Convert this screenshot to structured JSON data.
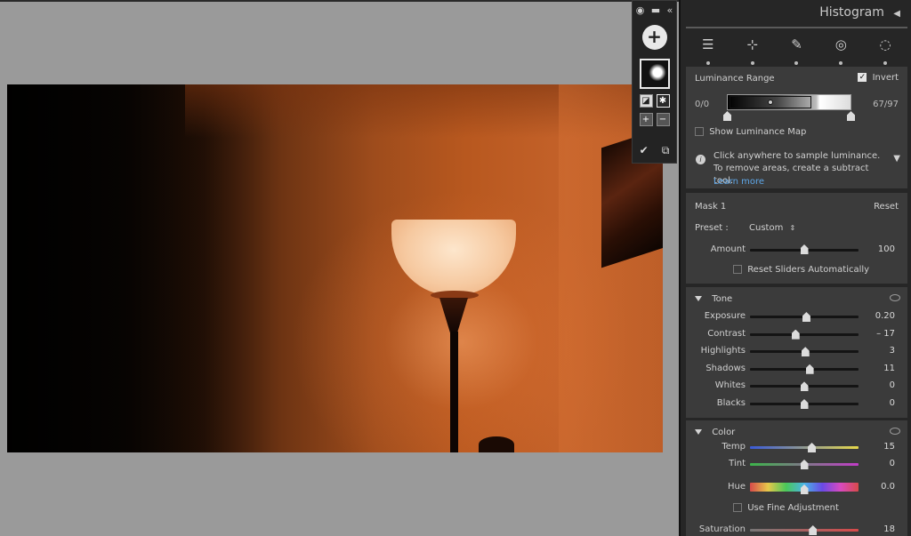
{
  "histogram": {
    "title": "Histogram",
    "collapse_icon": "triangle-left-icon"
  },
  "tools": [
    {
      "name": "edit-sliders-icon"
    },
    {
      "name": "crop-icon"
    },
    {
      "name": "healing-icon"
    },
    {
      "name": "redeye-icon"
    },
    {
      "name": "masking-icon"
    }
  ],
  "luminance": {
    "title": "Luminance Range",
    "invert_label": "Invert",
    "invert_checked": true,
    "range_left": "0/0",
    "range_right": "67/97",
    "show_map_label": "Show Luminance Map",
    "info_text": "Click anywhere to sample luminance. To remove areas, create a subtract tool.",
    "learn_more": "Learn more"
  },
  "mask": {
    "name": "Mask 1",
    "reset": "Reset",
    "preset_label": "Preset :",
    "preset_value": "Custom",
    "amount_label": "Amount",
    "amount_value": "100",
    "amount_pos": 0.5,
    "reset_sliders_label": "Reset Sliders Automatically"
  },
  "tone": {
    "title": "Tone",
    "sliders": [
      {
        "label": "Exposure",
        "value": "0.20",
        "pos": 0.52
      },
      {
        "label": "Contrast",
        "value": "– 17",
        "pos": 0.42
      },
      {
        "label": "Highlights",
        "value": "3",
        "pos": 0.51
      },
      {
        "label": "Shadows",
        "value": "11",
        "pos": 0.55
      },
      {
        "label": "Whites",
        "value": "0",
        "pos": 0.5
      },
      {
        "label": "Blacks",
        "value": "0",
        "pos": 0.5
      }
    ]
  },
  "color": {
    "title": "Color",
    "sliders": [
      {
        "label": "Temp",
        "value": "15",
        "pos": 0.57
      },
      {
        "label": "Tint",
        "value": "0",
        "pos": 0.5
      },
      {
        "label": "Hue",
        "value": "0.0",
        "pos": 0.5
      },
      {
        "label": "Saturation",
        "value": "18",
        "pos": 0.58
      }
    ],
    "fine_adjust_label": "Use Fine Adjustment"
  },
  "mask_panel": {
    "add_label": "+"
  }
}
